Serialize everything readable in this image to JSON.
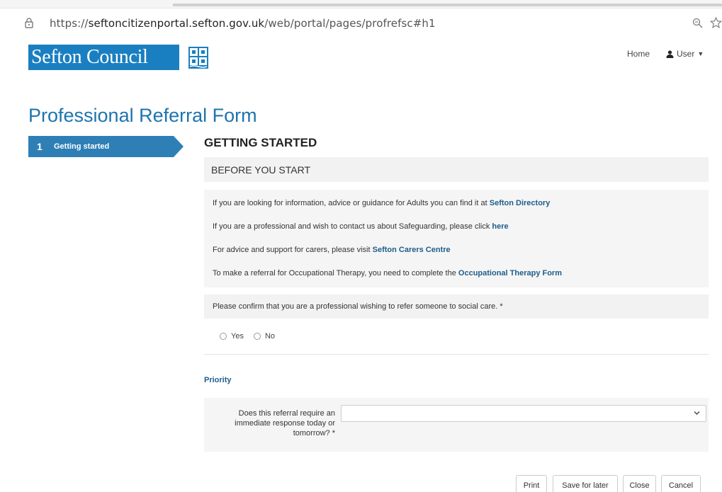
{
  "browser": {
    "url_prefix": "https://",
    "url_host": "seftoncitizenportal.sefton.gov.uk",
    "url_path": "/web/portal/pages/profrefsc#h1"
  },
  "header": {
    "logo_text": "Sefton Council",
    "nav_home": "Home",
    "nav_user": "User"
  },
  "page": {
    "title": "Professional Referral Form"
  },
  "steps": [
    {
      "number": "1",
      "label": "Getting started"
    }
  ],
  "section": {
    "title": "GETTING STARTED",
    "panel_title": "BEFORE YOU START"
  },
  "info": {
    "line1_text": "If you are looking for information, advice or guidance for Adults you can find it at ",
    "line1_link": "Sefton Directory",
    "line2_text": "If you are a professional and wish to contact us about Safeguarding, please click ",
    "line2_link": "here",
    "line3_text": "For advice and support for carers, please visit ",
    "line3_link": "Sefton Carers Centre",
    "line4_text": "To make a referral for Occupational Therapy, you need to complete the ",
    "line4_link": "Occupational Therapy Form"
  },
  "confirm": {
    "question": "Please confirm that you are a professional wishing to refer someone to social care. *",
    "option_yes": "Yes",
    "option_no": "No"
  },
  "priority": {
    "heading": "Priority",
    "question": "Does this referral require an immediate response today or tomorrow? *",
    "selected": ""
  },
  "buttons": {
    "print": "Print",
    "save": "Save for later",
    "close": "Close",
    "cancel": "Cancel"
  },
  "colors": {
    "brand_blue": "#1a7fc1",
    "step_blue": "#2e7fb6",
    "title_blue": "#1e74ae",
    "link_blue": "#1e5d8a"
  }
}
